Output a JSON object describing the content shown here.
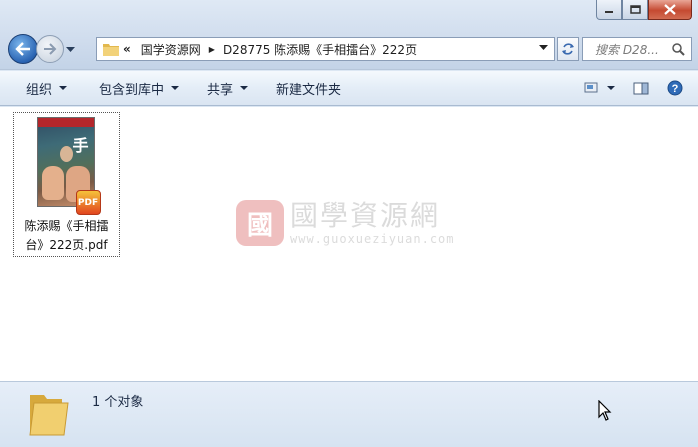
{
  "address": {
    "overflow": "«",
    "segments": [
      "国学资源网",
      "D28775 陈添赐《手相擂台》222页"
    ]
  },
  "search": {
    "placeholder": "搜索 D28..."
  },
  "toolbar": {
    "organize": "组织",
    "include_in_library": "包含到库中",
    "share": "共享",
    "new_folder": "新建文件夹"
  },
  "file": {
    "name": "陈添赐《手相擂台》222页.pdf",
    "badge": "PDF",
    "cover_text": "手"
  },
  "watermark": {
    "seal": "國",
    "title": "國學資源網",
    "url": "www.guoxueziyuan.com"
  },
  "status": {
    "count_text": "1 个对象"
  }
}
